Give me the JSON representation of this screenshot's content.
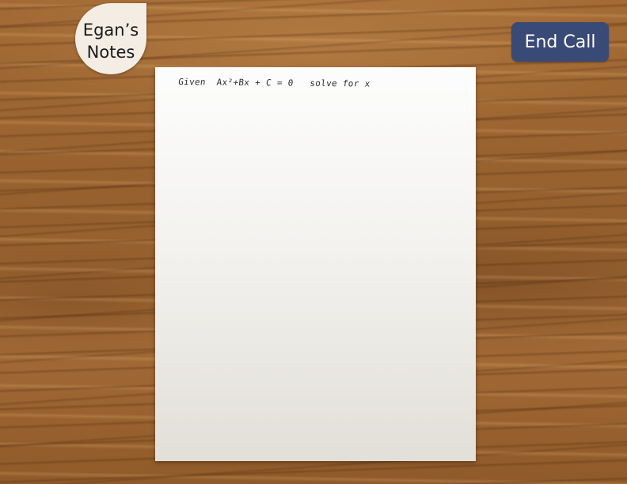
{
  "notes_badge": {
    "title": "Egan’s\nNotes"
  },
  "controls": {
    "end_call_label": "End Call"
  },
  "paper": {
    "handwritten_text": "Given  Ax²+Bx + C = 0   solve for x"
  },
  "colors": {
    "end_call_button": "#3a4a76",
    "badge_background": "#f3ede4",
    "paper": "#f7f6f3",
    "wood": "#9a6330"
  }
}
